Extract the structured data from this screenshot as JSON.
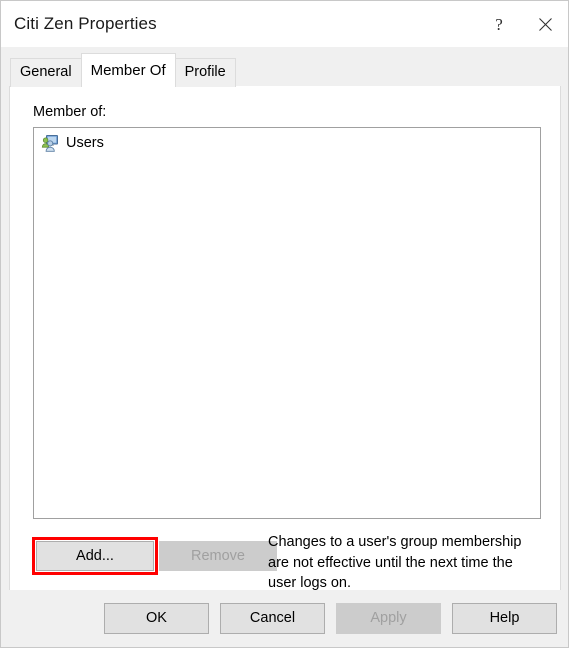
{
  "window": {
    "title": "Citi Zen Properties",
    "help_button": "?",
    "close_button": "×"
  },
  "tabs": [
    {
      "label": "General",
      "active": false
    },
    {
      "label": "Member Of",
      "active": true
    },
    {
      "label": "Profile",
      "active": false
    }
  ],
  "main": {
    "list_label": "Member of:",
    "list_items": [
      {
        "label": "Users",
        "icon": "group-icon"
      }
    ],
    "add_button": "Add...",
    "remove_button": "Remove",
    "note": "Changes to a user's group membership are not effective until the next time the user logs on."
  },
  "footer": {
    "ok": "OK",
    "cancel": "Cancel",
    "apply": "Apply",
    "help": "Help"
  },
  "colors": {
    "highlight": "#ff0000",
    "button_face": "#e1e1e1",
    "button_disabled": "#cccccc",
    "dialog_bg": "#f0f0f0",
    "panel_bg": "#ffffff"
  }
}
